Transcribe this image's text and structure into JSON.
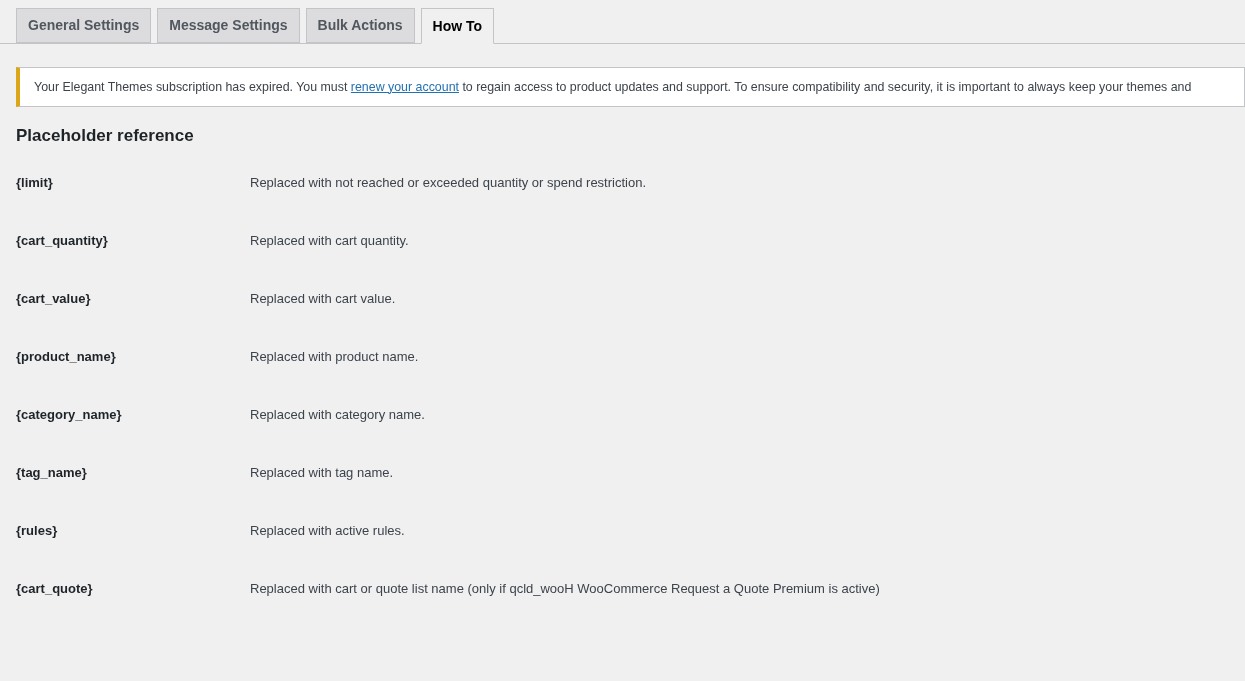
{
  "tabs": [
    {
      "label": "General Settings",
      "selected": false
    },
    {
      "label": "Message Settings",
      "selected": false
    },
    {
      "label": "Bulk Actions",
      "selected": false
    },
    {
      "label": "How To",
      "selected": true
    }
  ],
  "notice": {
    "text_before": "Your Elegant Themes subscription has expired. You must ",
    "link": "renew your account",
    "text_after": " to regain access to product updates and support. To ensure compatibility and security, it is important to always keep your themes and"
  },
  "heading": "Placeholder reference",
  "placeholders": [
    {
      "name": "{limit}",
      "description": "Replaced with not reached or exceeded quantity or spend restriction."
    },
    {
      "name": "{cart_quantity}",
      "description": "Replaced with cart quantity."
    },
    {
      "name": "{cart_value}",
      "description": "Replaced with cart value."
    },
    {
      "name": "{product_name}",
      "description": "Replaced with product name."
    },
    {
      "name": "{category_name}",
      "description": "Replaced with category name."
    },
    {
      "name": "{tag_name}",
      "description": "Replaced with tag name."
    },
    {
      "name": "{rules}",
      "description": "Replaced with active rules."
    },
    {
      "name": "{cart_quote}",
      "description": "Replaced with cart or quote list name (only if qcld_wooH WooCommerce Request a Quote Premium is active)"
    }
  ]
}
